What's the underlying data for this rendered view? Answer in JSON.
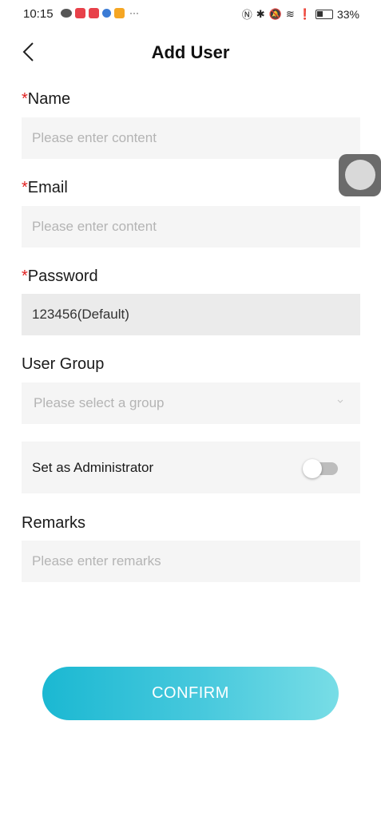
{
  "status_bar": {
    "time": "10:15",
    "more": "···",
    "battery": "33%"
  },
  "header": {
    "title": "Add User"
  },
  "form": {
    "required_mark": "*",
    "name": {
      "label": "Name",
      "placeholder": "Please enter content",
      "value": ""
    },
    "email": {
      "label": "Email",
      "placeholder": "Please enter content",
      "value": ""
    },
    "password": {
      "label": "Password",
      "value": "123456(Default)"
    },
    "user_group": {
      "label": "User Group",
      "placeholder": "Please select a group"
    },
    "admin": {
      "label": "Set as Administrator",
      "enabled": false
    },
    "remarks": {
      "label": "Remarks",
      "placeholder": "Please enter remarks",
      "value": ""
    }
  },
  "actions": {
    "confirm_label": "CONFIRM"
  },
  "colors": {
    "accent_start": "#1bb8d2",
    "accent_end": "#78dde6",
    "required": "#e02020"
  }
}
